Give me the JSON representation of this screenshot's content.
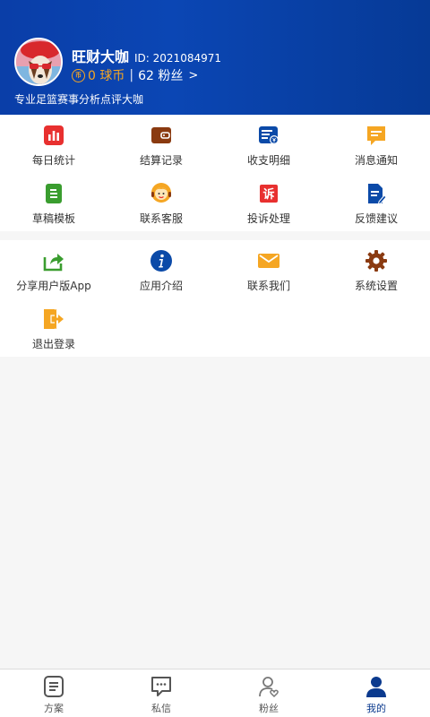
{
  "profile": {
    "name": "旺财大咖",
    "id_text": "ID: 2021084971",
    "coins": "0 球币",
    "coin_badge": "币",
    "separator": "|",
    "fans": "62 粉丝",
    "fans_arrow": ">",
    "bio": "专业足篮赛事分析点评大咖"
  },
  "menu1": [
    {
      "label": "每日统计",
      "icon": "bar-chart-icon",
      "color": "#e8302f"
    },
    {
      "label": "结算记录",
      "icon": "wallet-icon",
      "color": "#8a3a10"
    },
    {
      "label": "收支明细",
      "icon": "income-detail-icon",
      "color": "#0b4aa8"
    },
    {
      "label": "消息通知",
      "icon": "message-icon",
      "color": "#f5a623"
    },
    {
      "label": "草稿模板",
      "icon": "draft-icon",
      "color": "#3a9d2f"
    },
    {
      "label": "联系客服",
      "icon": "customer-service-icon",
      "color": "#f5a623"
    },
    {
      "label": "投诉处理",
      "icon": "complaint-icon",
      "color": "#e8302f"
    },
    {
      "label": "反馈建议",
      "icon": "feedback-icon",
      "color": "#0b4aa8"
    }
  ],
  "complaint_glyph": "诉",
  "menu2": [
    {
      "label": "分享用户版App",
      "icon": "share-icon",
      "color": "#3a9d2f"
    },
    {
      "label": "应用介绍",
      "icon": "info-icon",
      "color": "#0b4aa8"
    },
    {
      "label": "联系我们",
      "icon": "mail-icon",
      "color": "#f5a623"
    },
    {
      "label": "系统设置",
      "icon": "gear-icon",
      "color": "#8a3a10"
    },
    {
      "label": "退出登录",
      "icon": "logout-icon",
      "color": "#f5a623"
    }
  ],
  "tabs": [
    {
      "label": "方案",
      "icon": "plan-icon"
    },
    {
      "label": "私信",
      "icon": "chat-icon"
    },
    {
      "label": "粉丝",
      "icon": "fans-icon"
    },
    {
      "label": "我的",
      "icon": "me-icon",
      "active": true
    }
  ]
}
